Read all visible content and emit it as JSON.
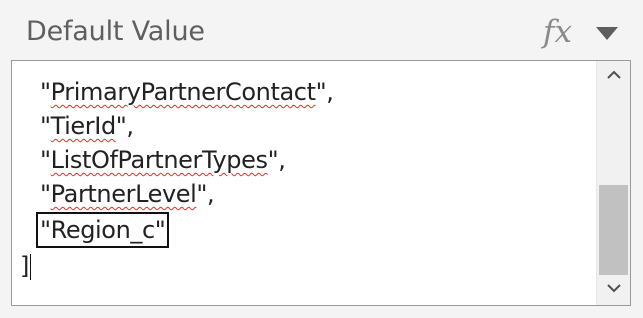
{
  "field": {
    "label": "Default Value",
    "fx_label": "fx",
    "dropdown_icon": "caret-down-icon"
  },
  "editor": {
    "lines": [
      {
        "text": "\"PrimaryPartnerContact\",",
        "squiggle": "PrimaryPartnerContact"
      },
      {
        "text": "\"TierId\",",
        "squiggle": "TierId"
      },
      {
        "text": "\"ListOfPartnerTypes\",",
        "squiggle": "ListOfPartnerTypes"
      },
      {
        "text": "\"PartnerLevel\",",
        "squiggle": "PartnerLevel"
      },
      {
        "text": "\"Region_c\"",
        "highlighted": true
      },
      {
        "text": "]"
      }
    ],
    "scrollbar": {
      "up_icon": "chevron-up-icon",
      "down_icon": "chevron-down-icon"
    }
  }
}
